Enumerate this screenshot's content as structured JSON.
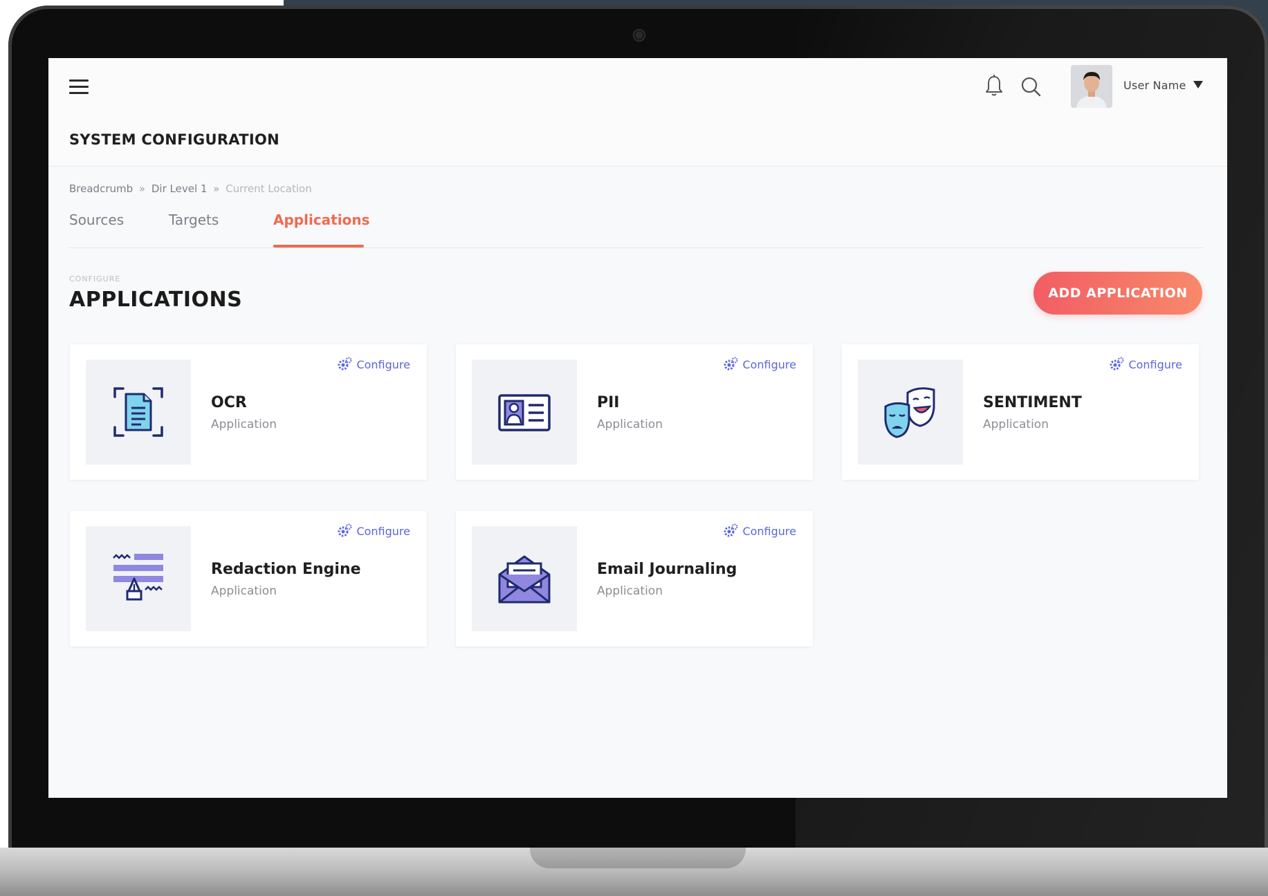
{
  "header": {
    "user_name": "User Name"
  },
  "page": {
    "title": "SYSTEM CONFIGURATION",
    "breadcrumb": [
      "Breadcrumb",
      "Dir Level 1",
      "Current Location"
    ],
    "breadcrumb_separator": "»"
  },
  "tabs": [
    {
      "label": "Sources",
      "active": false
    },
    {
      "label": "Targets",
      "active": false
    },
    {
      "label": "Applications",
      "active": true
    }
  ],
  "section": {
    "eyebrow": "CONFIGURE",
    "title": "APPLICATIONS",
    "add_button_label": "ADD APPLICATION"
  },
  "cards": [
    {
      "title": "OCR",
      "subtitle": "Application",
      "configure_label": "Configure",
      "icon": "ocr-document-icon"
    },
    {
      "title": "PII",
      "subtitle": "Application",
      "configure_label": "Configure",
      "icon": "id-card-icon"
    },
    {
      "title": "SENTIMENT",
      "subtitle": "Application",
      "configure_label": "Configure",
      "icon": "theater-masks-icon"
    },
    {
      "title": "Redaction Engine",
      "subtitle": "Application",
      "configure_label": "Configure",
      "icon": "redaction-pen-icon"
    },
    {
      "title": "Email Journaling",
      "subtitle": "Application",
      "configure_label": "Configure",
      "icon": "open-envelope-icon"
    }
  ],
  "colors": {
    "accent": "#f06a4f",
    "button_gradient_start": "#f25d64",
    "button_gradient_end": "#f8896a",
    "link": "#5b66e0",
    "icon_navy": "#1f2a6e",
    "icon_cyan": "#7fd3ec",
    "icon_purple": "#8f87e0"
  }
}
